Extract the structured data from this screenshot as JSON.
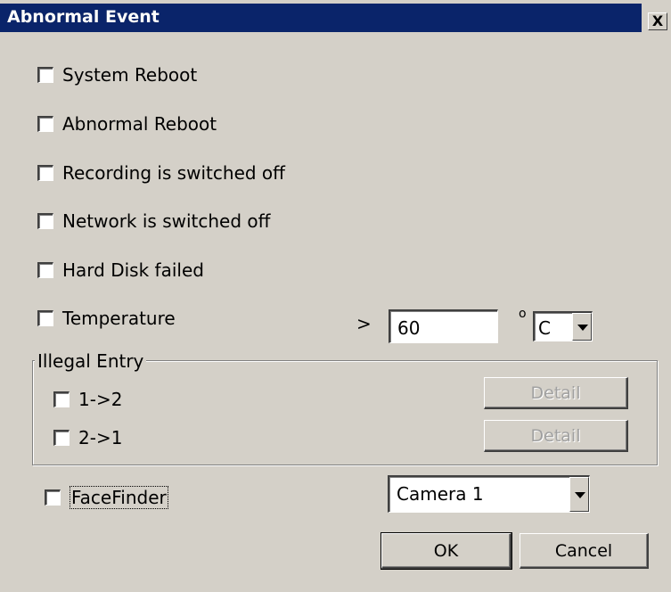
{
  "window": {
    "title": "Abnormal Event",
    "close_label": "X"
  },
  "events": [
    {
      "label": "System Reboot",
      "checked": false
    },
    {
      "label": "Abnormal Reboot",
      "checked": false
    },
    {
      "label": "Recording is switched off",
      "checked": false
    },
    {
      "label": "Network is switched off",
      "checked": false
    },
    {
      "label": "Hard Disk failed",
      "checked": false
    },
    {
      "label": "Temperature",
      "checked": false
    }
  ],
  "temperature": {
    "operator": ">",
    "value": "60",
    "degree_symbol": "o",
    "unit": "C"
  },
  "illegal_entry": {
    "legend": "Illegal Entry",
    "items": [
      {
        "label": "1->2",
        "checked": false,
        "detail_label": "Detail"
      },
      {
        "label": "2->1",
        "checked": false,
        "detail_label": "Detail"
      }
    ]
  },
  "facefinder": {
    "label": "FaceFinder",
    "checked": false,
    "camera": "Camera 1"
  },
  "buttons": {
    "ok": "OK",
    "cancel": "Cancel"
  }
}
